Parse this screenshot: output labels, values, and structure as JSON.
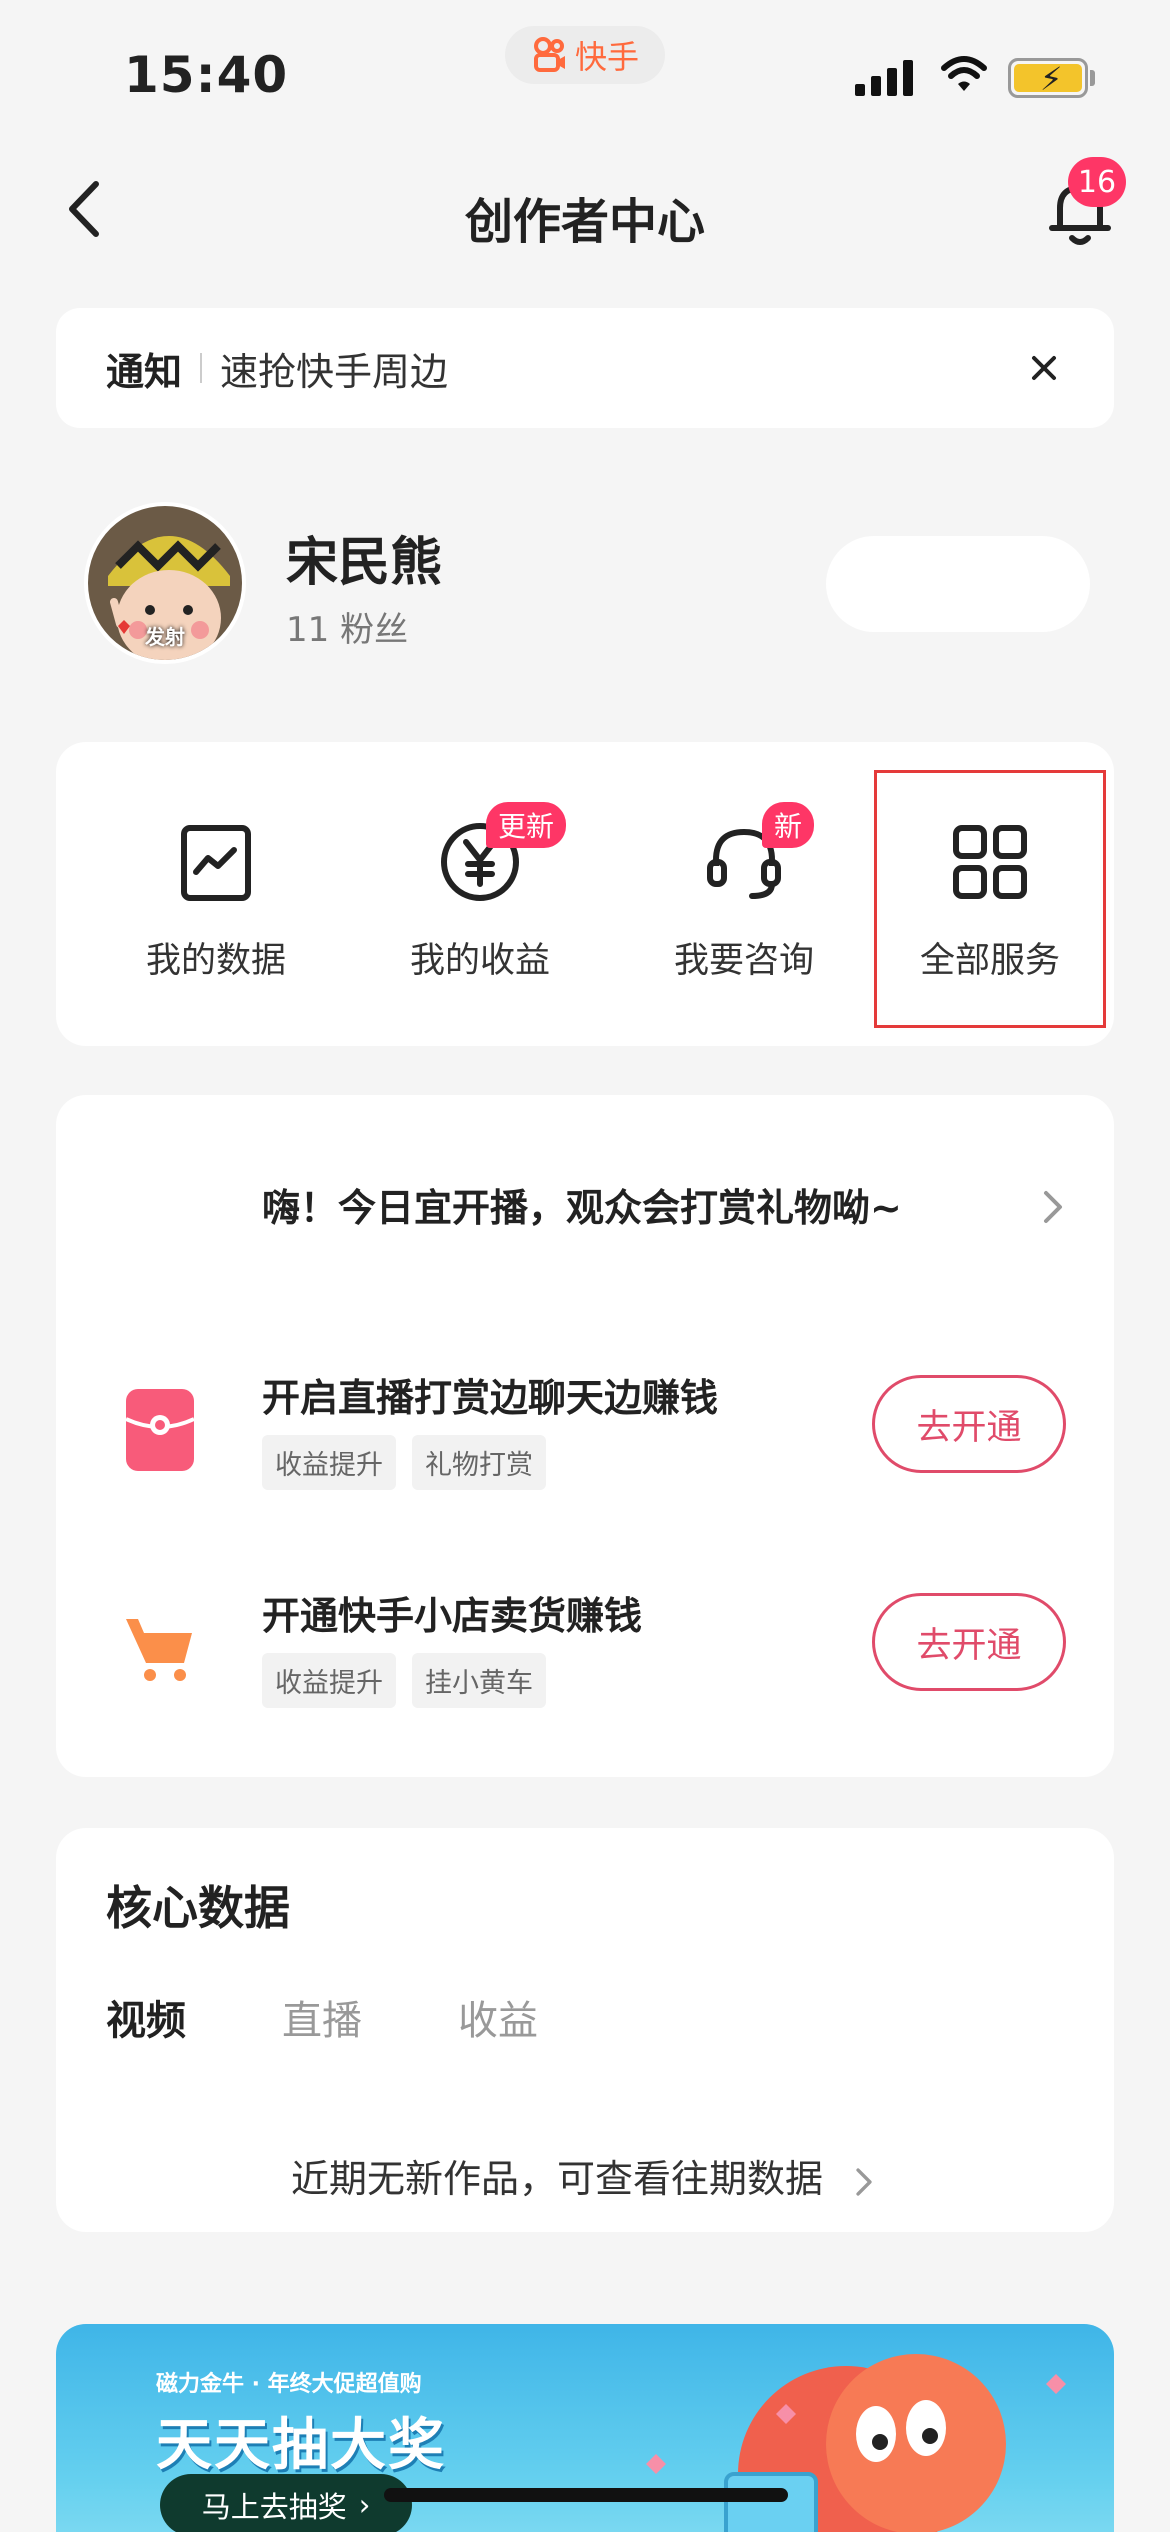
{
  "status_bar": {
    "time": "15:40",
    "app_name": "快手",
    "accent_color": "#ff6a3d"
  },
  "navbar": {
    "title": "创作者中心",
    "notification_count": "16"
  },
  "notice": {
    "label": "通知",
    "text": "速抢快手周边"
  },
  "profile": {
    "username": "宋民熊",
    "fans": "11 粉丝",
    "avatar_caption": "发射"
  },
  "services": [
    {
      "label": "我的数据",
      "icon": "data-chart-icon",
      "badge": ""
    },
    {
      "label": "我的收益",
      "icon": "yuan-icon",
      "badge": "更新"
    },
    {
      "label": "我要咨询",
      "icon": "headset-icon",
      "badge": "新"
    },
    {
      "label": "全部服务",
      "icon": "grid-icon",
      "badge": ""
    }
  ],
  "promo": {
    "headline": "嗨！今日宜开播，观众会打赏礼物呦~",
    "tasks": [
      {
        "title": "开启直播打赏边聊天边赚钱",
        "tags": [
          "收益提升",
          "礼物打赏"
        ],
        "button": "去开通",
        "icon": "red-envelope-icon"
      },
      {
        "title": "开通快手小店卖货赚钱",
        "tags": [
          "收益提升",
          "挂小黄车"
        ],
        "button": "去开通",
        "icon": "shopping-cart-icon"
      }
    ]
  },
  "core_data": {
    "title": "核心数据",
    "tabs": [
      {
        "label": "视频",
        "active": true
      },
      {
        "label": "直播",
        "active": false
      },
      {
        "label": "收益",
        "active": false
      }
    ],
    "empty_text": "近期无新作品，可查看往期数据"
  },
  "banner": {
    "subtitle": "磁力金牛 · 年终大促超值购",
    "title": "天天抽大奖",
    "button": "马上去抽奖"
  },
  "colors": {
    "badge": "#fe3666",
    "button_outline": "#e04b6a",
    "highlight_box": "#e43a3a"
  }
}
